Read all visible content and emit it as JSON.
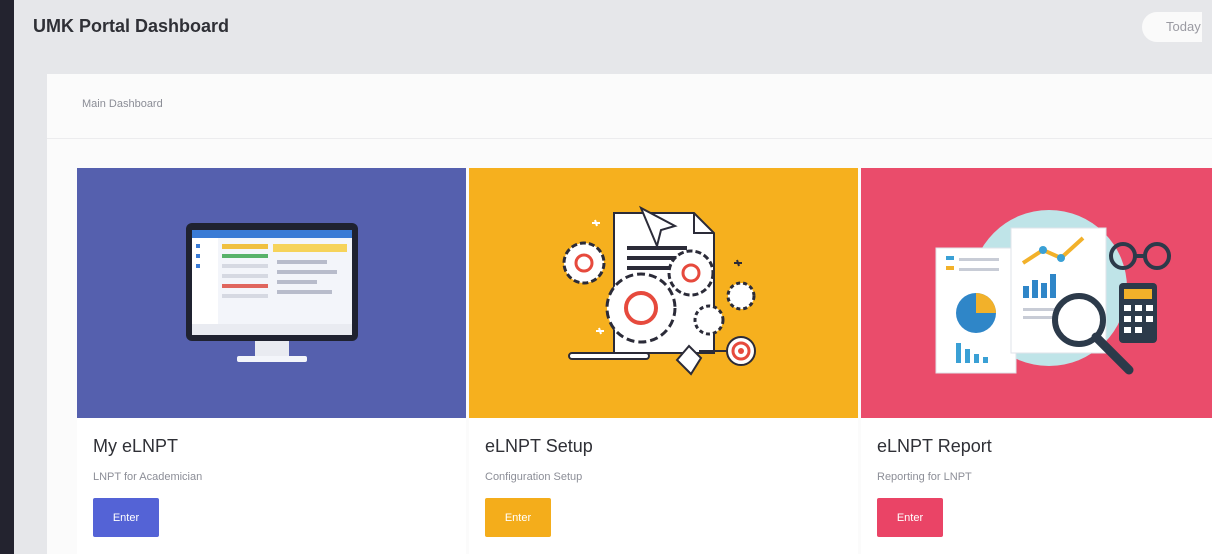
{
  "header": {
    "title": "UMK Portal Dashboard",
    "date_label": "Today"
  },
  "breadcrumb": {
    "label": "Main Dashboard"
  },
  "cards": [
    {
      "title": "My eLNPT",
      "subtitle": "LNPT for Academician",
      "button": "Enter",
      "color": "#5560ae",
      "button_color": "#5463d6",
      "icon": "computer-monitor-illustration"
    },
    {
      "title": "eLNPT Setup",
      "subtitle": "Configuration Setup",
      "button": "Enter",
      "color": "#f6b01e",
      "button_color": "#f4ad1b",
      "icon": "gears-settings-illustration"
    },
    {
      "title": "eLNPT Report",
      "subtitle": "Reporting for LNPT",
      "button": "Enter",
      "color": "#ea4c6b",
      "button_color": "#ea4466",
      "icon": "report-analytics-illustration"
    }
  ],
  "colors": {
    "sidebar": "#23232f",
    "background": "#e6e7ea"
  }
}
